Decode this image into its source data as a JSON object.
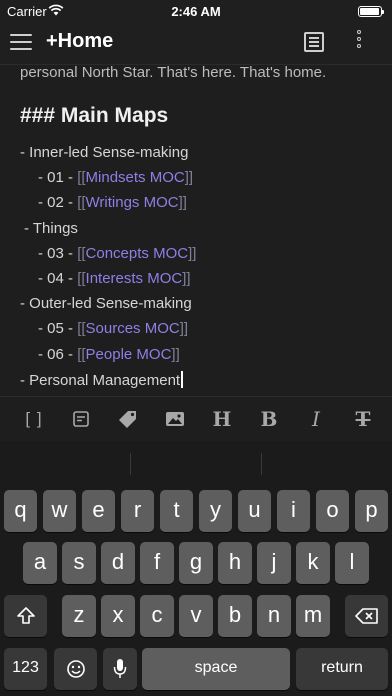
{
  "status": {
    "carrier": "Carrier",
    "time": "2:46 AM"
  },
  "nav": {
    "title": "+Home"
  },
  "editor": {
    "top_line": "personal North Star. That's here. That's home.",
    "heading": "### Main Maps",
    "group1": "- Inner-led Sense-making",
    "item1_prefix": "- 01 - ",
    "item1_link": "Mindsets MOC",
    "item2_prefix": "- 02 - ",
    "item2_link": "Writings MOC",
    "group2": "- Things",
    "item3_prefix": "- 03 - ",
    "item3_link": "Concepts MOC",
    "item4_prefix": "- 04 - ",
    "item4_link": "Interests MOC",
    "group3": "- Outer-led Sense-making",
    "item5_prefix": "- 05 - ",
    "item5_link": "Sources MOC",
    "item6_prefix": "- 06 - ",
    "item6_link": "People MOC",
    "group4": "- Personal Management",
    "open_bracket": "[[",
    "close_bracket": "]]"
  },
  "toolbar": {
    "wikilink": "[ ]",
    "heading": "H",
    "bold": "B",
    "italic": "I",
    "strike": "T"
  },
  "keyboard": {
    "row1": [
      "q",
      "w",
      "e",
      "r",
      "t",
      "y",
      "u",
      "i",
      "o",
      "p"
    ],
    "row2": [
      "a",
      "s",
      "d",
      "f",
      "g",
      "h",
      "j",
      "k",
      "l"
    ],
    "row3": [
      "z",
      "x",
      "c",
      "v",
      "b",
      "n",
      "m"
    ],
    "numbers": "123",
    "space": "space",
    "return": "return"
  }
}
